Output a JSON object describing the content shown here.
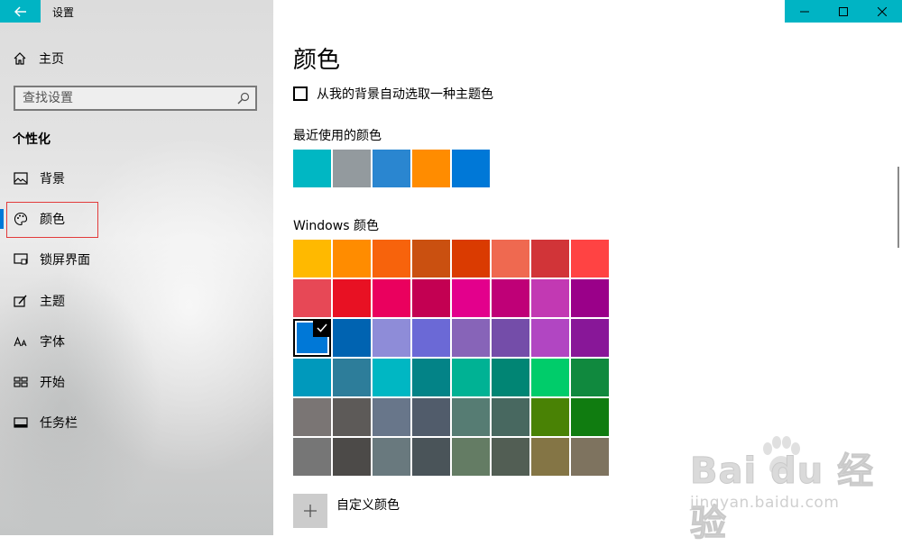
{
  "window": {
    "app_title": "设置",
    "controls": [
      "minimize-icon",
      "maximize-icon",
      "close-icon"
    ],
    "accent": "#00b4c4"
  },
  "sidebar": {
    "home_label": "主页",
    "search_placeholder": "查找设置",
    "section_heading": "个性化",
    "selected_index": 1,
    "items": [
      {
        "label": "背景",
        "icon": "picture-icon"
      },
      {
        "label": "颜色",
        "icon": "palette-icon"
      },
      {
        "label": "锁屏界面",
        "icon": "lock-screen-icon"
      },
      {
        "label": "主题",
        "icon": "theme-icon"
      },
      {
        "label": "字体",
        "icon": "font-icon"
      },
      {
        "label": "开始",
        "icon": "start-icon"
      },
      {
        "label": "任务栏",
        "icon": "taskbar-icon"
      }
    ]
  },
  "main": {
    "title": "颜色",
    "auto_pick_label": "从我的背景自动选取一种主题色",
    "auto_pick_checked": false,
    "recent_label": "最近使用的颜色",
    "recent_colors": [
      "#00b7c3",
      "#939a9e",
      "#2a86d0",
      "#ff8c00",
      "#0078d7"
    ],
    "windows_colors_label": "Windows 颜色",
    "windows_colors": [
      [
        "#ffb900",
        "#ff8c00",
        "#f7630c",
        "#ca5010",
        "#da3b01",
        "#ef6950",
        "#d13438",
        "#ff4343"
      ],
      [
        "#e74856",
        "#e81123",
        "#ea005e",
        "#c30052",
        "#e3008c",
        "#bf0077",
        "#c239b3",
        "#9a0089"
      ],
      [
        "#0078d7",
        "#0063b1",
        "#8e8cd8",
        "#6b69d6",
        "#8764b8",
        "#744da9",
        "#b146c2",
        "#881798"
      ],
      [
        "#0099bc",
        "#2d7d9a",
        "#00b7c3",
        "#038387",
        "#00b294",
        "#018574",
        "#00cc6a",
        "#10893e"
      ],
      [
        "#7a7574",
        "#5d5a58",
        "#68768a",
        "#515c6b",
        "#567c73",
        "#486860",
        "#498205",
        "#107c10"
      ],
      [
        "#767676",
        "#4c4a48",
        "#69797e",
        "#4a5459",
        "#647c64",
        "#525e54",
        "#847545",
        "#7e735f"
      ]
    ],
    "selected_color": {
      "row": 2,
      "col": 0
    },
    "custom_color_label": "自定义颜色"
  },
  "watermark": {
    "logo_text": "Bai du 经验",
    "url": "jingyan.baidu.com"
  }
}
